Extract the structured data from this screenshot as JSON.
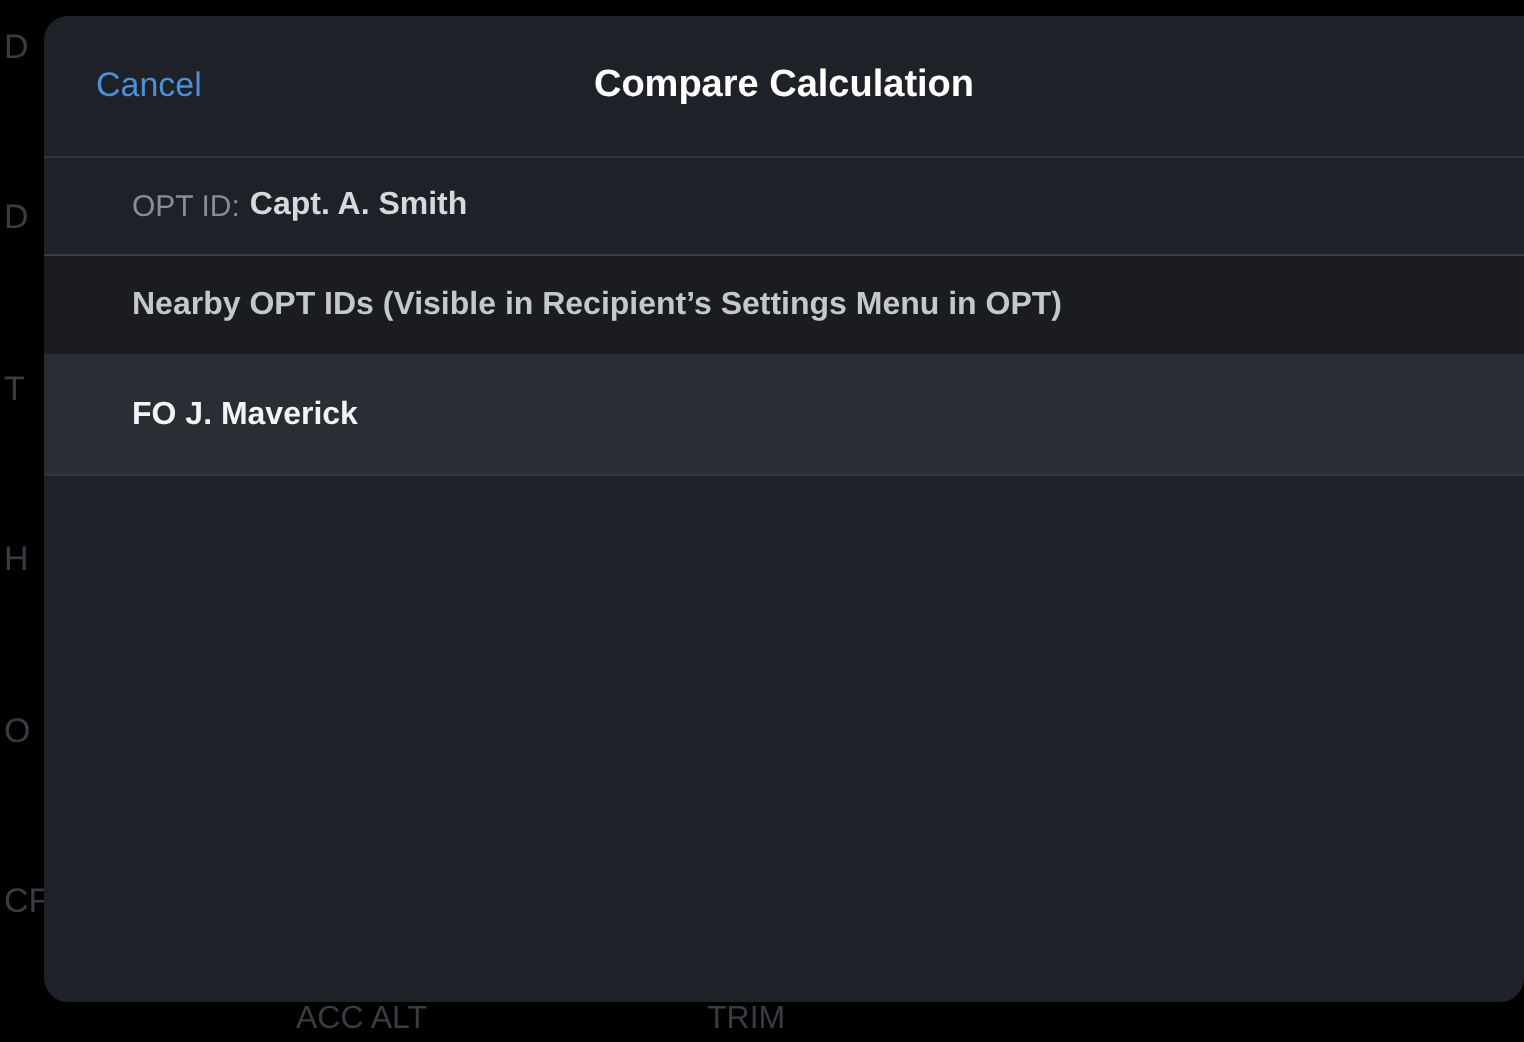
{
  "background_labels": {
    "left": [
      "D",
      "D",
      "T",
      "H",
      "O",
      "CF"
    ],
    "bottom": [
      "ACC ALT",
      "TRIM"
    ]
  },
  "dialog": {
    "cancel": "Cancel",
    "title": "Compare Calculation",
    "opt_id": {
      "label": "OPT ID:",
      "value": "Capt. A. Smith"
    },
    "section_header": "Nearby OPT IDs (Visible in Recipient’s Settings Menu in OPT)",
    "recipients": [
      {
        "name": "FO J. Maverick",
        "selected": true
      }
    ]
  }
}
